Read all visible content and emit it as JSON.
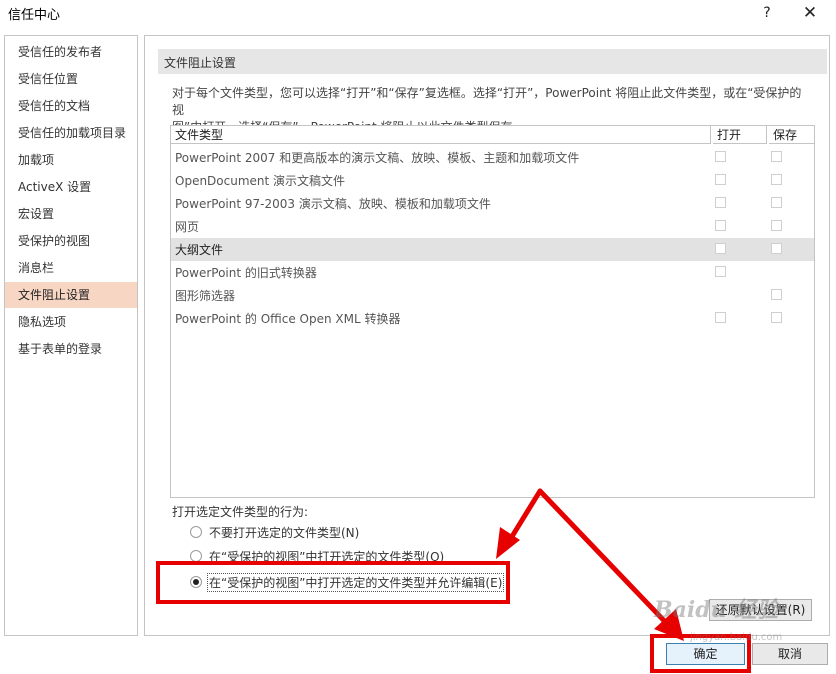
{
  "window": {
    "title": "信任中心",
    "help_glyph": "?",
    "close_glyph": "✕"
  },
  "nav": {
    "items": [
      {
        "label": "受信任的发布者"
      },
      {
        "label": "受信任位置"
      },
      {
        "label": "受信任的文档"
      },
      {
        "label": "受信任的加载项目录"
      },
      {
        "label": "加载项"
      },
      {
        "label": "ActiveX 设置"
      },
      {
        "label": "宏设置"
      },
      {
        "label": "受保护的视图"
      },
      {
        "label": "消息栏"
      },
      {
        "label": "文件阻止设置"
      },
      {
        "label": "隐私选项"
      },
      {
        "label": "基于表单的登录"
      }
    ],
    "selected": "文件阻止设置"
  },
  "section": {
    "title": "文件阻止设置",
    "description_line1": "对于每个文件类型，您可以选择“打开”和“保存”复选框。选择“打开”，PowerPoint 将阻止此文件类型，或在“受保护的视",
    "description_line2": "图”中打开。选择“保存”，PowerPoint 将阻止以此文件类型保存。"
  },
  "table": {
    "headers": {
      "type": "文件类型",
      "open": "打开",
      "save": "保存"
    },
    "rows": [
      {
        "label": "PowerPoint 2007 和更高版本的演示文稿、放映、模板、主题和加载项文件",
        "open": false,
        "save": false,
        "has_open": true,
        "has_save": true
      },
      {
        "label": "OpenDocument 演示文稿文件",
        "open": false,
        "save": false,
        "has_open": true,
        "has_save": true
      },
      {
        "label": "PowerPoint 97-2003 演示文稿、放映、模板和加载项文件",
        "open": false,
        "save": false,
        "has_open": true,
        "has_save": true
      },
      {
        "label": "网页",
        "open": false,
        "save": false,
        "has_open": true,
        "has_save": true
      },
      {
        "label": "大纲文件",
        "open": false,
        "save": false,
        "has_open": true,
        "has_save": true,
        "selected": true
      },
      {
        "label": "PowerPoint 的旧式转换器",
        "open": false,
        "has_open": true,
        "has_save": false
      },
      {
        "label": "图形筛选器",
        "save": false,
        "has_open": false,
        "has_save": true
      },
      {
        "label": "PowerPoint 的 Office Open XML 转换器",
        "open": false,
        "save": false,
        "has_open": true,
        "has_save": true
      }
    ]
  },
  "behavior": {
    "label": "打开选定文件类型的行为:",
    "options": [
      {
        "label": "不要打开选定的文件类型(N)",
        "checked": false
      },
      {
        "label": "在“受保护的视图”中打开选定的文件类型(O)",
        "checked": false
      },
      {
        "label": "在“受保护的视图”中打开选定的文件类型并允许编辑(E)",
        "checked": true
      }
    ]
  },
  "buttons": {
    "restore_defaults": "还原默认设置(R)",
    "ok": "确定",
    "cancel": "取消"
  },
  "annotation": {
    "highlight_color": "#e60000"
  },
  "watermark": {
    "text": "Baidu 经验",
    "sub": "jingyan.baidu.com"
  }
}
